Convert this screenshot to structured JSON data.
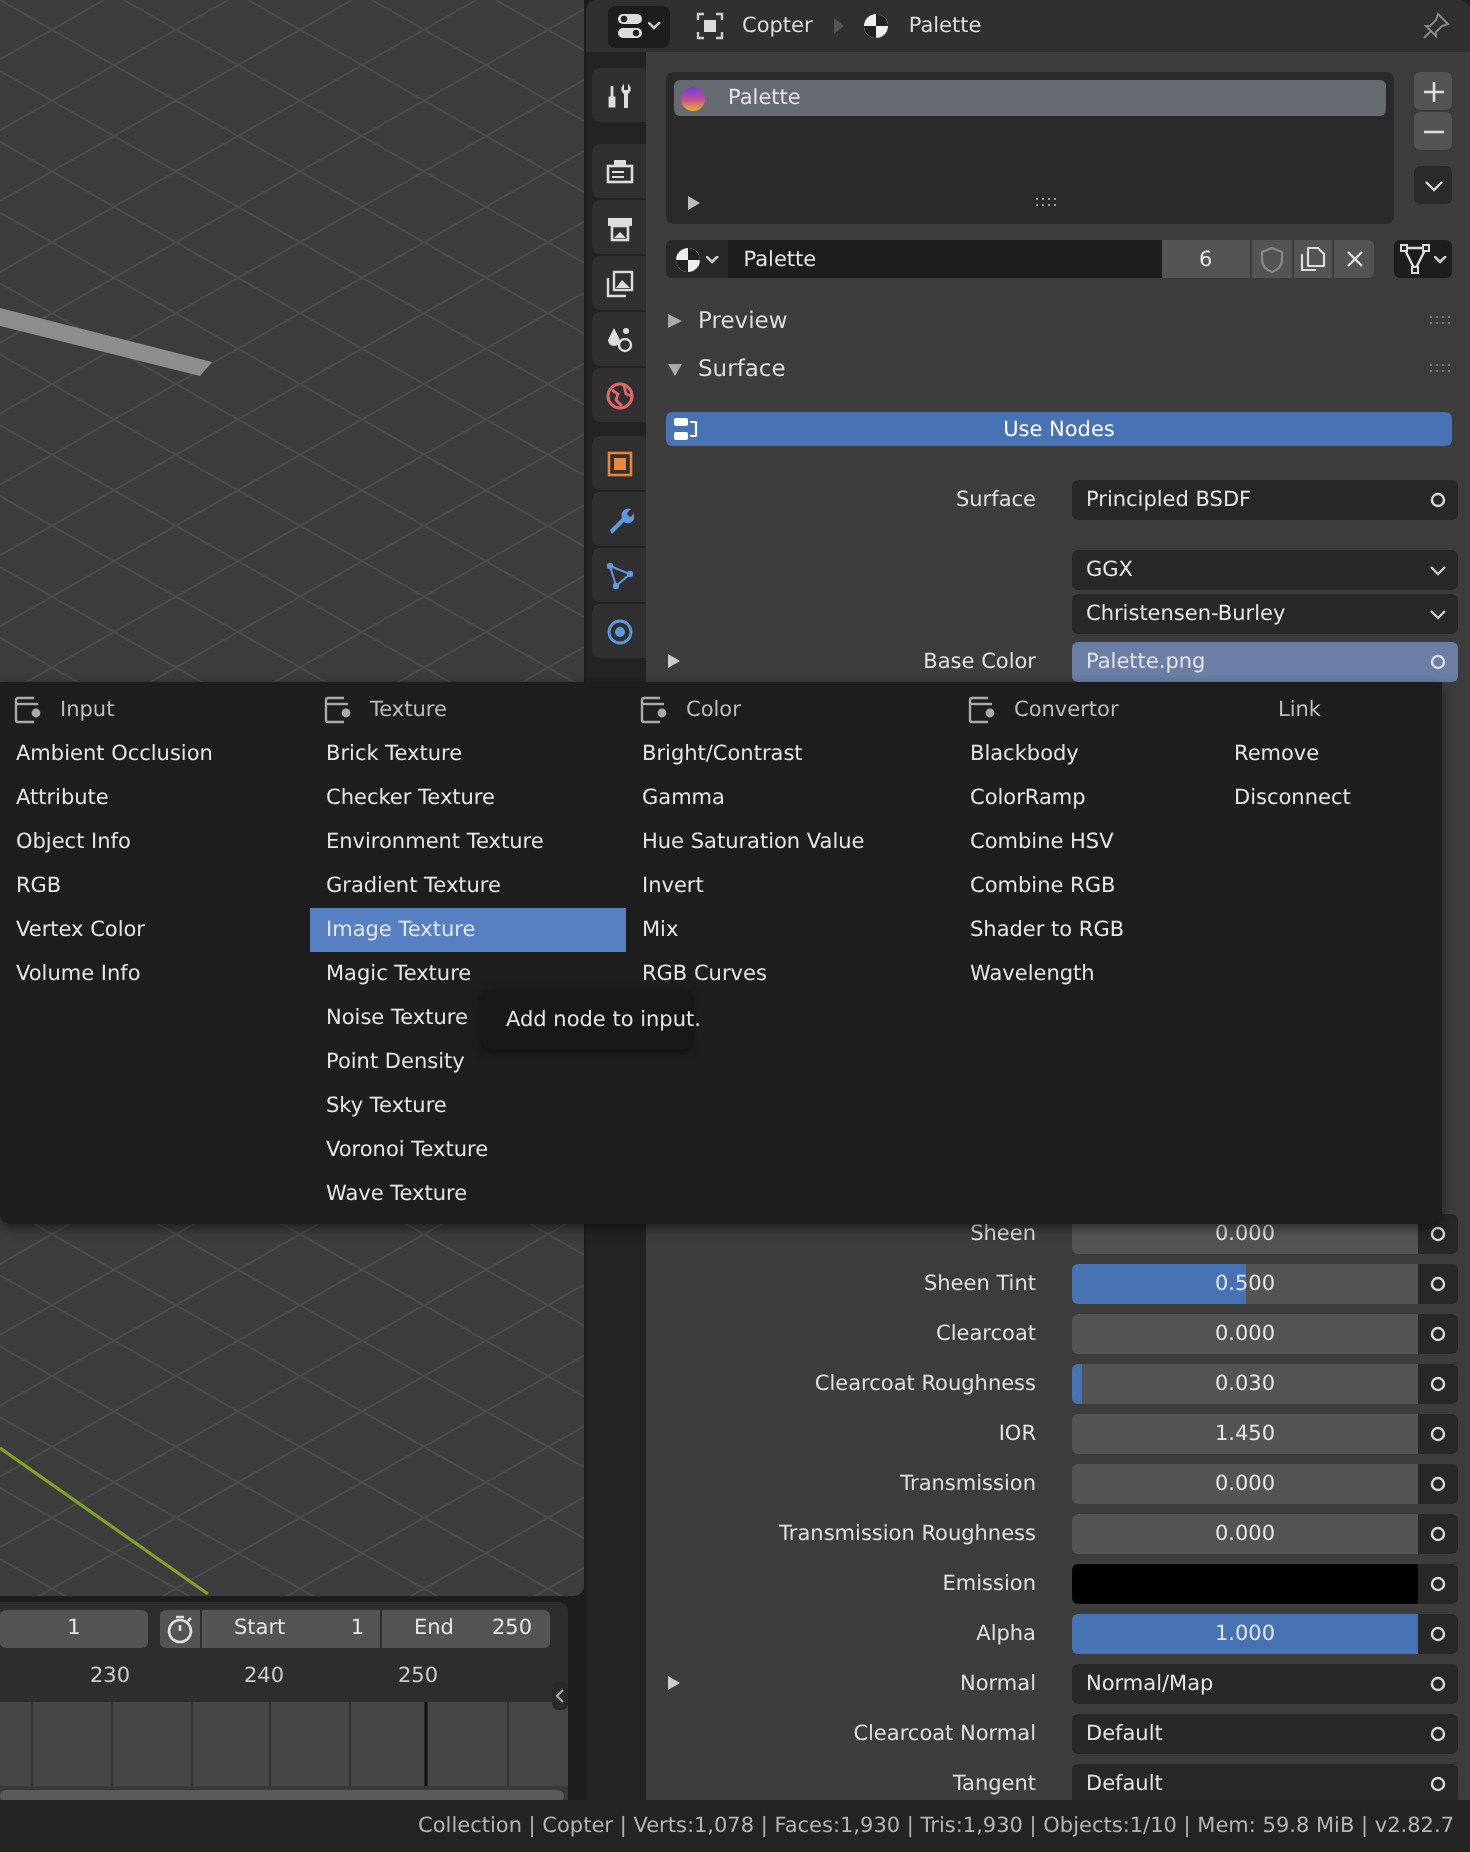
{
  "properties_header": {
    "object": "Copter",
    "material": "Palette"
  },
  "material_slots": [
    {
      "name": "Palette",
      "selected": true
    }
  ],
  "material_field": {
    "name": "Palette",
    "users": "6"
  },
  "panels": [
    {
      "title": "Preview",
      "expanded": false
    },
    {
      "title": "Surface",
      "expanded": true
    }
  ],
  "use_nodes_button": "Use Nodes",
  "surface_settings": [
    {
      "kind": "link",
      "label": "Surface",
      "value": "Principled BSDF",
      "highlighted": false,
      "expander": false
    },
    {
      "kind": "enum",
      "value": "GGX",
      "highlighted": false,
      "expander": false
    },
    {
      "kind": "enum",
      "value": "Christensen-Burley",
      "highlighted": false,
      "expander": false
    },
    {
      "kind": "link",
      "label": "Base Color",
      "value": "Palette.png",
      "highlighted": true,
      "expander": true
    }
  ],
  "shader_inputs": [
    {
      "kind": "slider",
      "label": "Sheen",
      "value": "0.000",
      "level": 0,
      "expander": false
    },
    {
      "kind": "slider",
      "label": "Sheen Tint",
      "value": "0.500",
      "level": 0.5,
      "expander": false
    },
    {
      "kind": "slider",
      "label": "Clearcoat",
      "value": "0.000",
      "level": 0,
      "expander": false
    },
    {
      "kind": "slider",
      "label": "Clearcoat Roughness",
      "value": "0.030",
      "level": 0.03,
      "expander": false
    },
    {
      "kind": "number",
      "label": "IOR",
      "value": "1.450",
      "expander": false
    },
    {
      "kind": "slider",
      "label": "Transmission",
      "value": "0.000",
      "level": 0,
      "expander": false
    },
    {
      "kind": "slider",
      "label": "Transmission Roughness",
      "value": "0.000",
      "level": 0,
      "expander": false
    },
    {
      "kind": "color",
      "label": "Emission",
      "color": "#000000",
      "expander": false
    },
    {
      "kind": "slider",
      "label": "Alpha",
      "value": "1.000",
      "level": 1,
      "expander": false
    },
    {
      "kind": "link",
      "label": "Normal",
      "value": "Normal/Map",
      "highlighted": false,
      "expander": true
    },
    {
      "kind": "link",
      "label": "Clearcoat Normal",
      "value": "Default",
      "highlighted": false,
      "expander": false
    },
    {
      "kind": "link",
      "label": "Tangent",
      "value": "Default",
      "highlighted": false,
      "expander": false
    }
  ],
  "node_menu": {
    "columns": [
      {
        "kind": "category",
        "title": "Input",
        "items": [
          {
            "label": "Ambient Occlusion",
            "selected": false
          },
          {
            "label": "Attribute",
            "selected": false
          },
          {
            "label": "Object Info",
            "selected": false
          },
          {
            "label": "RGB",
            "selected": false
          },
          {
            "label": "Vertex Color",
            "selected": false
          },
          {
            "label": "Volume Info",
            "selected": false
          }
        ]
      },
      {
        "kind": "category",
        "title": "Texture",
        "items": [
          {
            "label": "Brick Texture",
            "selected": false
          },
          {
            "label": "Checker Texture",
            "selected": false
          },
          {
            "label": "Environment Texture",
            "selected": false
          },
          {
            "label": "Gradient Texture",
            "selected": false
          },
          {
            "label": "Image Texture",
            "selected": true
          },
          {
            "label": "Magic Texture",
            "selected": false
          },
          {
            "label": "Noise Texture",
            "selected": false
          },
          {
            "label": "Point Density",
            "selected": false
          },
          {
            "label": "Sky Texture",
            "selected": false
          },
          {
            "label": "Voronoi Texture",
            "selected": false
          },
          {
            "label": "Wave Texture",
            "selected": false
          }
        ]
      },
      {
        "kind": "category",
        "title": "Color",
        "items": [
          {
            "label": "Bright/Contrast",
            "selected": false
          },
          {
            "label": "Gamma",
            "selected": false
          },
          {
            "label": "Hue Saturation Value",
            "selected": false
          },
          {
            "label": "Invert",
            "selected": false
          },
          {
            "label": "Mix",
            "selected": false
          },
          {
            "label": "RGB Curves",
            "selected": false
          }
        ]
      },
      {
        "kind": "category",
        "title": "Convertor",
        "items": [
          {
            "label": "Blackbody",
            "selected": false
          },
          {
            "label": "ColorRamp",
            "selected": false
          },
          {
            "label": "Combine HSV",
            "selected": false
          },
          {
            "label": "Combine RGB",
            "selected": false
          },
          {
            "label": "Shader to RGB",
            "selected": false
          },
          {
            "label": "Wavelength",
            "selected": false
          }
        ]
      },
      {
        "kind": "action",
        "title": "Link",
        "items": [
          {
            "label": "Remove",
            "selected": false
          },
          {
            "label": "Disconnect",
            "selected": false
          }
        ]
      }
    ]
  },
  "tooltip": "Add node to input.",
  "timeline": {
    "current_frame": "1",
    "start_label": "Start",
    "start": "1",
    "end_label": "End",
    "end": "250",
    "ruler": [
      "230",
      "240",
      "250"
    ]
  },
  "status_bar": "Collection | Copter | Verts:1,078 | Faces:1,930 | Tris:1,930 | Objects:1/10 | Mem: 59.8 MiB | v2.82.7"
}
